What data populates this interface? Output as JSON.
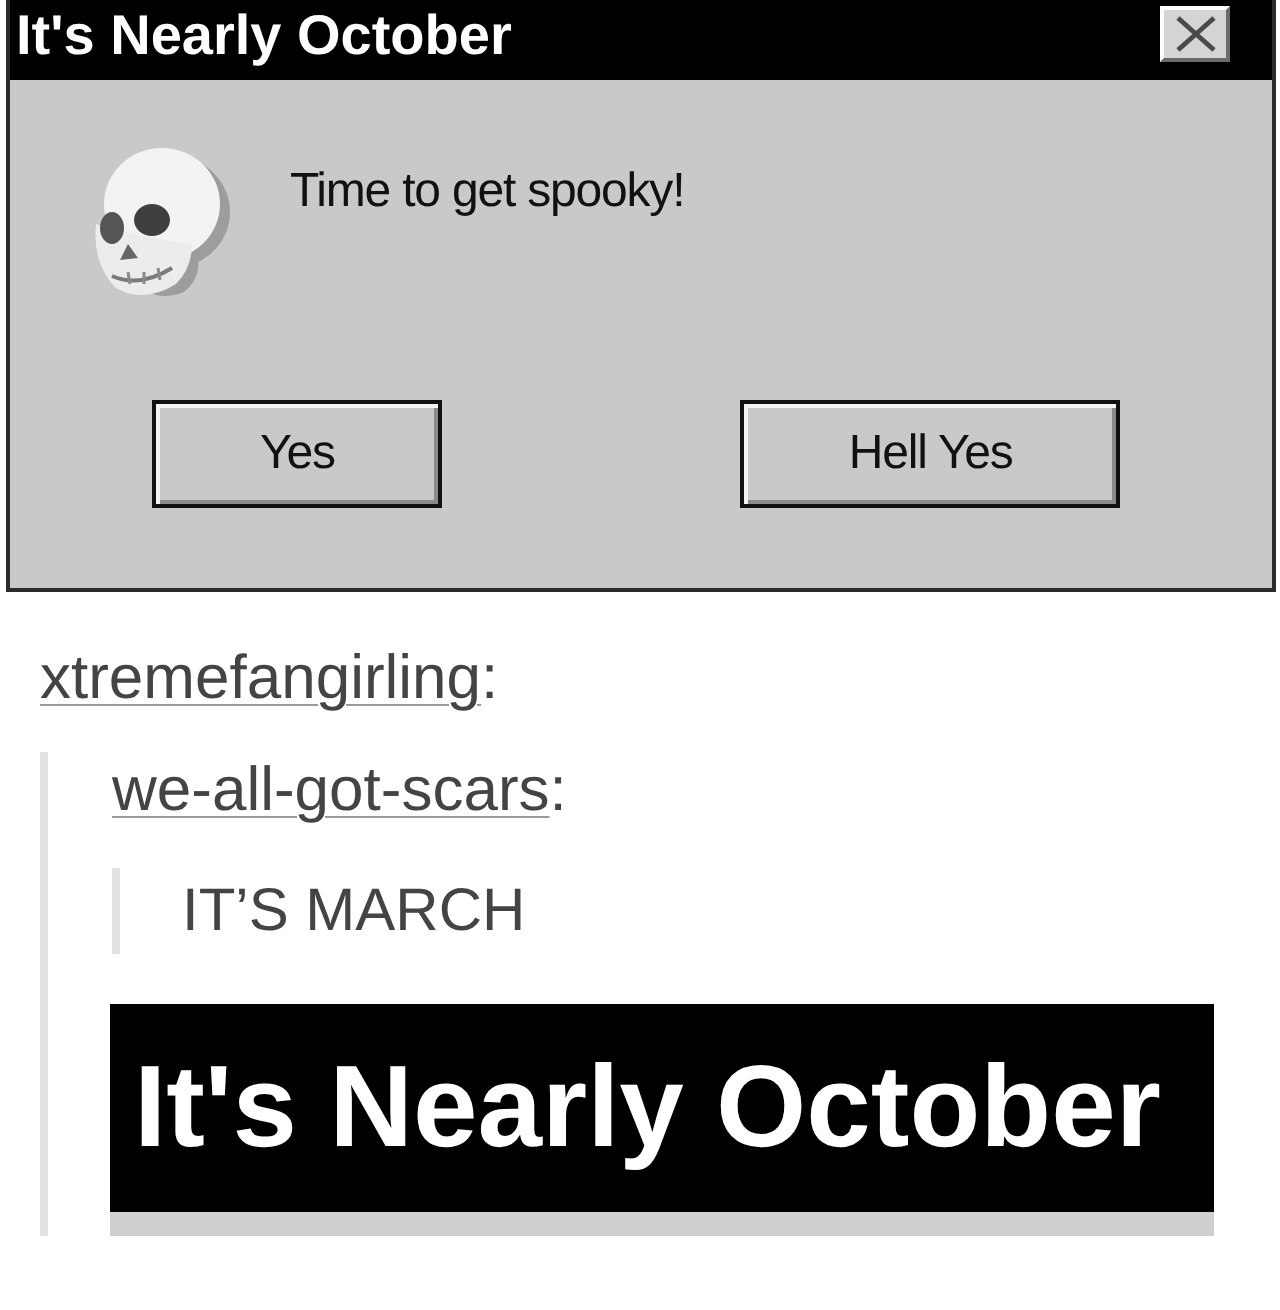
{
  "dialog": {
    "title": "It's Nearly October",
    "message": "Time to get spooky!",
    "buttons": [
      {
        "label": "Yes"
      },
      {
        "label": "Hell Yes"
      }
    ]
  },
  "reblog": {
    "user": "xtremefangirling",
    "suffix": ":",
    "quote": {
      "user": "we-all-got-scars",
      "suffix": ":",
      "text": "IT’S MARCH"
    },
    "reply_image": {
      "title": "It's Nearly October"
    }
  }
}
